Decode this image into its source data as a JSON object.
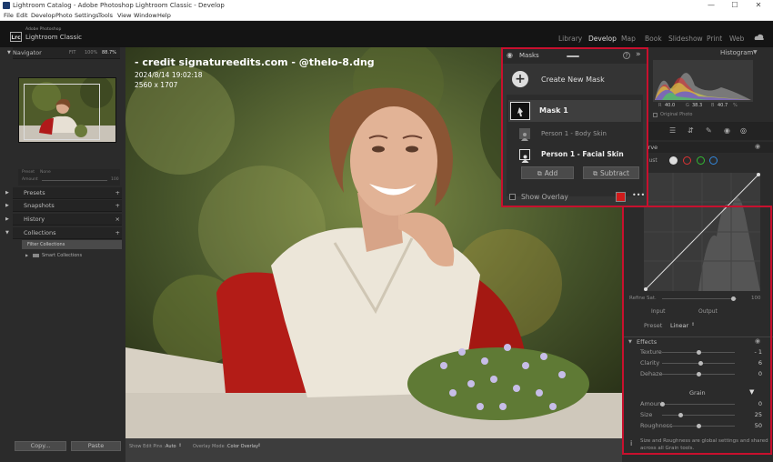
{
  "window": {
    "title": "Lightroom Catalog - Adobe Photoshop Lightroom Classic - Develop",
    "minimize": "—",
    "maximize": "☐",
    "close": "✕"
  },
  "menu": [
    "File",
    "Edit",
    "Develop",
    "Photo",
    "Settings",
    "Tools",
    "View",
    "Window",
    "Help"
  ],
  "identity": {
    "logo": "Lrc",
    "line1": "Adobe Photoshop",
    "line2": "Lightroom Classic"
  },
  "modules": [
    "Library",
    "Develop",
    "Map",
    "Book",
    "Slideshow",
    "Print",
    "Web"
  ],
  "active_module": "Develop",
  "left_panel": {
    "navigator": {
      "title": "Navigator",
      "fit": "FIT",
      "fill": "100%",
      "zoom": "88.7%"
    },
    "preset_row": {
      "label": "Preset",
      "value": "None",
      "amount_label": "Amount",
      "amount_value": "100"
    },
    "sections": [
      {
        "label": "Presets",
        "action": "+"
      },
      {
        "label": "Snapshots",
        "action": "+"
      },
      {
        "label": "History",
        "action": "×"
      },
      {
        "label": "Collections",
        "action": "+"
      }
    ],
    "collections": [
      "Filter Collections",
      "Smart Collections"
    ],
    "copy_button": "Copy...",
    "paste_button": "Paste"
  },
  "photo": {
    "credit": "- credit  signatureedits.com - @thelo-8.dng",
    "datetime": "2024/8/14 19:02:18",
    "dimensions": "2560 x 1707"
  },
  "toolbar": {
    "show_edit_pins_label": "Show Edit Pins :",
    "show_edit_pins_value": "Auto",
    "overlay_mode_label": "Overlay Mode :",
    "overlay_mode_value": "Color Overlay"
  },
  "masks": {
    "title": "Masks",
    "help": "?",
    "collapse": "»",
    "create_new": "Create New Mask",
    "mask_name": "Mask 1",
    "components": [
      "Person 1 - Body Skin",
      "Person 1 - Facial Skin"
    ],
    "add_button": "Add",
    "subtract_button": "Subtract",
    "show_overlay": "Show Overlay",
    "overlay_color": "#d11b1b",
    "more": "•••"
  },
  "histogram": {
    "title": "Histogram",
    "stats": [
      "R",
      "40.0",
      "G",
      "38.3",
      "B",
      "40.7",
      "%"
    ],
    "original_photo": "Original Photo"
  },
  "curve": {
    "title": "Curve",
    "adjust_label": "Adjust",
    "refine_label": "Refine Sat.",
    "refine_value": "100",
    "input_label": "Input",
    "output_label": "Output",
    "preset_label": "Preset",
    "preset_value": "Linear"
  },
  "effects": {
    "title": "Effects",
    "sliders": [
      {
        "label": "Texture",
        "value": "- 1",
        "level": 0.5
      },
      {
        "label": "Clarity",
        "value": "6",
        "level": 0.53
      },
      {
        "label": "Dehaze",
        "value": "0",
        "level": 0.5
      }
    ],
    "grain_title": "Grain",
    "grain_sliders": [
      {
        "label": "Amount",
        "value": "0",
        "level": 0.0
      },
      {
        "label": "Size",
        "value": "25",
        "level": 0.25
      },
      {
        "label": "Roughness",
        "value": "50",
        "level": 0.5
      }
    ],
    "note": "Size and Roughness are global settings and shared across all Grain tools."
  },
  "colors": {
    "highlight_red": "#c8102e",
    "panel_bg": "#2b2b2b",
    "mask_bg": "#343434",
    "active_text": "#dddddd"
  }
}
